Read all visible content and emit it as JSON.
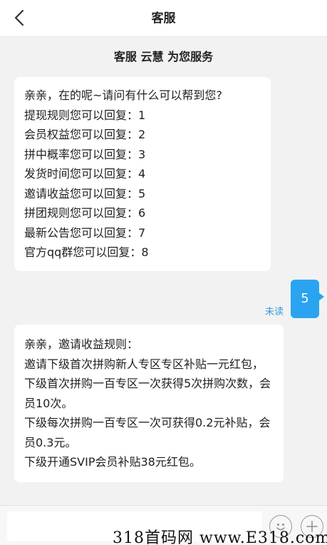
{
  "header": {
    "title": "客服",
    "back_icon": "chevron-left-icon"
  },
  "chat": {
    "banner": "客服 云慧 为您服务",
    "messages": [
      {
        "lines": [
          "亲亲，在的呢~请问有什么可以帮到您?",
          "提现规则您可以回复：1",
          "会员权益您可以回复：2",
          "拼中概率您可以回复：3",
          "发货时间您可以回复：4",
          "邀请收益您可以回复：5",
          "拼团规则您可以回复：6",
          "最新公告您可以回复：7",
          "官方qq群您可以回复：8"
        ]
      },
      {
        "text": "5",
        "status": "未读"
      },
      {
        "lines": [
          "亲亲，邀请收益规则：",
          "邀请下级首次拼购新人专区专区补贴一元红包，",
          "下级首次拼购一百专区一次获得5次拼购次数，会员10次。",
          "下级每次拼购一百专区一次可获得0.2元补贴，会员0.3元。",
          "下级开通SVIP会员补贴38元红包。"
        ]
      }
    ]
  },
  "input_bar": {
    "value": "",
    "emoji_icon": "emoji-icon",
    "plus_icon": "plus-icon"
  },
  "watermark": "318首码网 www.E318.com",
  "colors": {
    "user_bubble": "#2aa4f0",
    "unread_text": "#3a9bdc",
    "background": "#f2f2f2"
  }
}
